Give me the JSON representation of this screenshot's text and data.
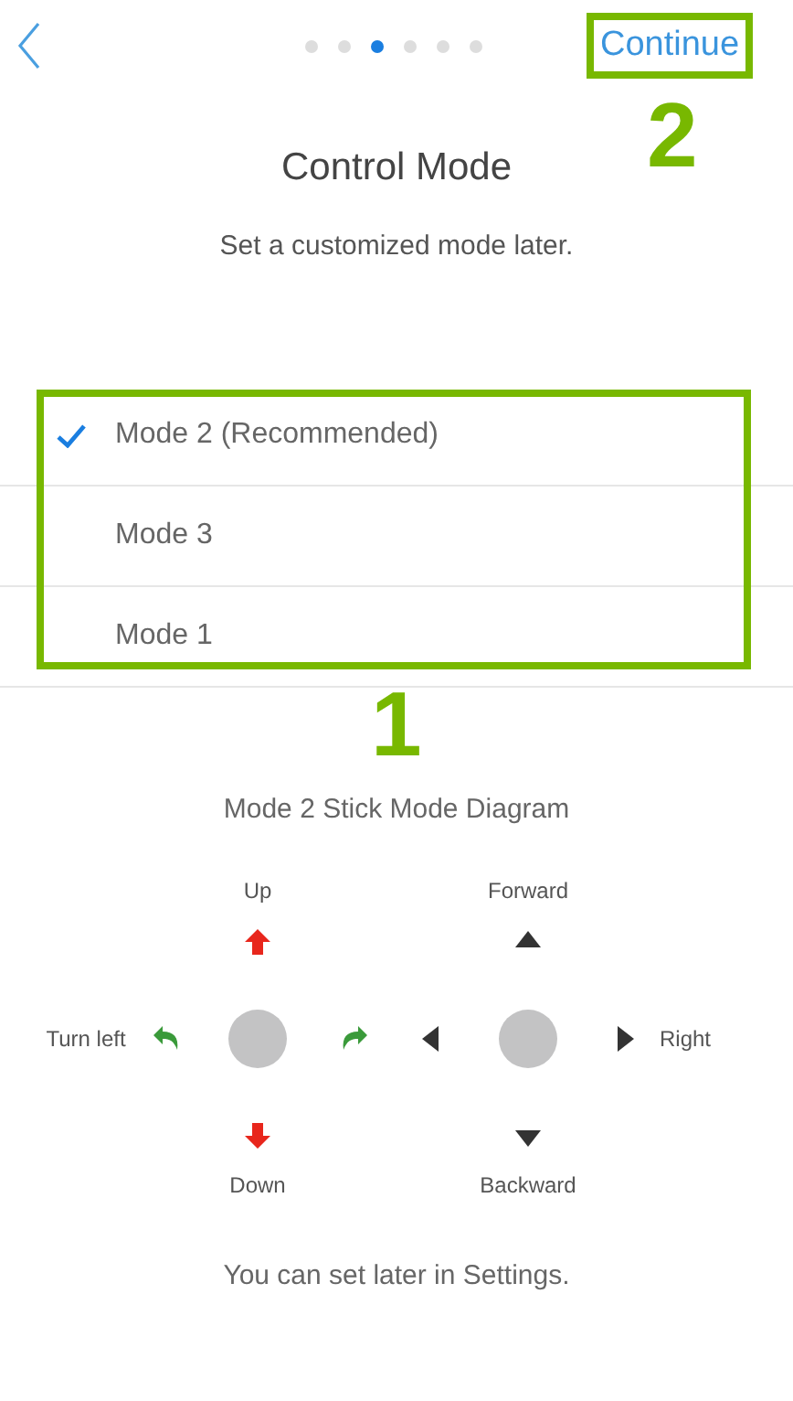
{
  "header": {
    "pages": [
      {
        "selected": false
      },
      {
        "selected": false
      },
      {
        "selected": true
      },
      {
        "selected": false
      },
      {
        "selected": false
      },
      {
        "selected": false
      }
    ],
    "continue": "Continue",
    "continue_annotation": "2"
  },
  "title": "Control Mode",
  "subtitle": "Set a customized mode later.",
  "modes": [
    {
      "label": "Mode 2 (Recommended)",
      "selected": true
    },
    {
      "label": "Mode 3",
      "selected": false
    },
    {
      "label": "Mode 1",
      "selected": false
    }
  ],
  "modes_annotation": "1",
  "diagram": {
    "title": "Mode 2 Stick Mode Diagram",
    "sticks": [
      {
        "kind": "altitude-yaw",
        "up": "Up",
        "down": "Down",
        "left": "Turn left"
      },
      {
        "kind": "pitch-roll",
        "up": "Forward",
        "down": "Backward",
        "right": "Right"
      }
    ]
  },
  "footer": "You can set later in Settings."
}
